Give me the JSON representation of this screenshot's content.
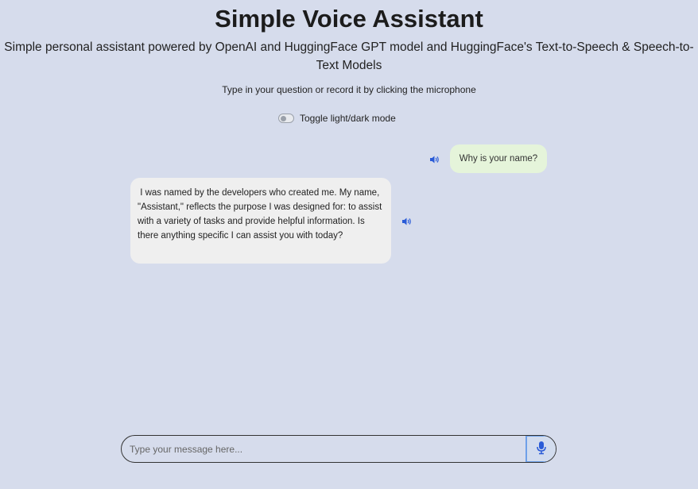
{
  "header": {
    "title": "Simple Voice Assistant",
    "subtitle": "Simple personal assistant powered by OpenAI and HuggingFace GPT model and HuggingFace's Text-to-Speech & Speech-to-Text Models",
    "instructions": "Type in your question or record it by clicking the microphone"
  },
  "theme_toggle": {
    "label": "Toggle light/dark mode",
    "checked": false
  },
  "chat": {
    "messages": [
      {
        "role": "user",
        "text": "Why is your name?",
        "audio_icon": "speaker-icon"
      },
      {
        "role": "assistant",
        "text": " I was named by the developers who created me. My name, \"Assistant,\" reflects the purpose I was designed for: to assist with a variety of tasks and provide helpful information. Is there anything specific I can assist you with today?",
        "audio_icon": "speaker-icon"
      }
    ]
  },
  "composer": {
    "placeholder": "Type your message here...",
    "value": "",
    "mic_icon": "microphone-icon"
  },
  "colors": {
    "background": "#d6dcec",
    "user_bubble": "#e5f4da",
    "assistant_bubble": "#efefef",
    "accent": "#2a5bd7"
  }
}
